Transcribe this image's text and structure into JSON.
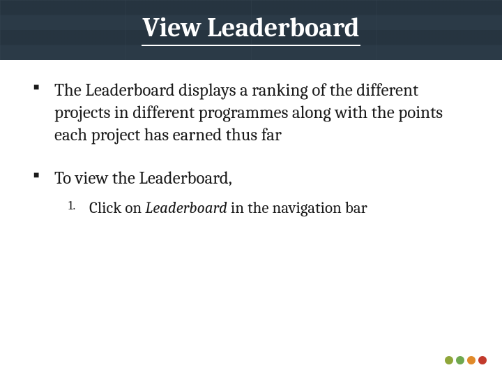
{
  "title": "View Leaderboard",
  "bullet1": "The Leaderboard displays a ranking of the different projects in different programmes along with the points each project has earned thus far",
  "bullet2": "To view the Leaderboard,",
  "step1_num": "1.",
  "step1_prefix": "Click on ",
  "step1_italic": "Leaderboard",
  "step1_suffix": " in the navigation bar"
}
